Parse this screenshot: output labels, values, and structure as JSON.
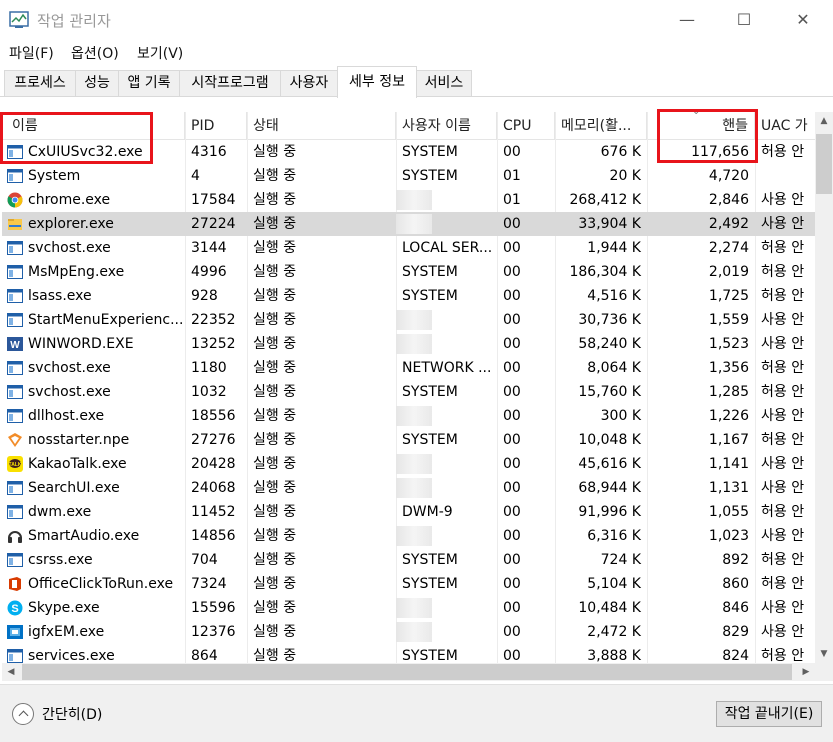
{
  "window": {
    "title": "작업 관리자",
    "minimize_glyph": "—",
    "maximize_glyph": "☐",
    "close_glyph": "✕"
  },
  "menu": [
    "파일(F)",
    "옵션(O)",
    "보기(V)"
  ],
  "tabs": [
    "프로세스",
    "성능",
    "앱 기록",
    "시작프로그램",
    "사용자",
    "세부 정보",
    "서비스"
  ],
  "active_tab": "세부 정보",
  "columns": {
    "name": "이름",
    "pid": "PID",
    "status": "상태",
    "user": "사용자 이름",
    "cpu": "CPU",
    "memory": "메모리(활...",
    "handles": "핸들",
    "uac": "UAC 가"
  },
  "sort_column": "handles",
  "rows": [
    {
      "name": "CxUIUSvc32.exe",
      "pid": "4316",
      "status": "실행 중",
      "user": "SYSTEM",
      "cpu": "00",
      "memory": "676 K",
      "handles": "117,656",
      "uac": "허용 안",
      "icon": "service-window-icon"
    },
    {
      "name": "System",
      "pid": "4",
      "status": "실행 중",
      "user": "SYSTEM",
      "cpu": "01",
      "memory": "20 K",
      "handles": "4,720",
      "uac": "",
      "icon": "service-window-icon"
    },
    {
      "name": "chrome.exe",
      "pid": "17584",
      "status": "실행 중",
      "user": "",
      "cpu": "01",
      "memory": "268,412 K",
      "handles": "2,846",
      "uac": "사용 안",
      "icon": "chrome-icon"
    },
    {
      "name": "explorer.exe",
      "pid": "27224",
      "status": "실행 중",
      "user": "",
      "cpu": "00",
      "memory": "33,904 K",
      "handles": "2,492",
      "uac": "사용 안",
      "icon": "folder-icon"
    },
    {
      "name": "svchost.exe",
      "pid": "3144",
      "status": "실행 중",
      "user": "LOCAL SER...",
      "cpu": "00",
      "memory": "1,944 K",
      "handles": "2,274",
      "uac": "허용 안",
      "icon": "service-window-icon"
    },
    {
      "name": "MsMpEng.exe",
      "pid": "4996",
      "status": "실행 중",
      "user": "SYSTEM",
      "cpu": "00",
      "memory": "186,304 K",
      "handles": "2,019",
      "uac": "허용 안",
      "icon": "service-window-icon"
    },
    {
      "name": "lsass.exe",
      "pid": "928",
      "status": "실행 중",
      "user": "SYSTEM",
      "cpu": "00",
      "memory": "4,516 K",
      "handles": "1,725",
      "uac": "허용 안",
      "icon": "service-window-icon"
    },
    {
      "name": "StartMenuExperienc...",
      "pid": "22352",
      "status": "실행 중",
      "user": "",
      "cpu": "00",
      "memory": "30,736 K",
      "handles": "1,559",
      "uac": "사용 안",
      "icon": "service-window-icon"
    },
    {
      "name": "WINWORD.EXE",
      "pid": "13252",
      "status": "실행 중",
      "user": "",
      "cpu": "00",
      "memory": "58,240 K",
      "handles": "1,523",
      "uac": "사용 안",
      "icon": "word-icon"
    },
    {
      "name": "svchost.exe",
      "pid": "1180",
      "status": "실행 중",
      "user": "NETWORK ...",
      "cpu": "00",
      "memory": "8,064 K",
      "handles": "1,356",
      "uac": "허용 안",
      "icon": "service-window-icon"
    },
    {
      "name": "svchost.exe",
      "pid": "1032",
      "status": "실행 중",
      "user": "SYSTEM",
      "cpu": "00",
      "memory": "15,760 K",
      "handles": "1,285",
      "uac": "허용 안",
      "icon": "service-window-icon"
    },
    {
      "name": "dllhost.exe",
      "pid": "18556",
      "status": "실행 중",
      "user": "",
      "cpu": "00",
      "memory": "300 K",
      "handles": "1,226",
      "uac": "사용 안",
      "icon": "service-window-icon"
    },
    {
      "name": "nosstarter.npe",
      "pid": "27276",
      "status": "실행 중",
      "user": "SYSTEM",
      "cpu": "00",
      "memory": "10,048 K",
      "handles": "1,167",
      "uac": "허용 안",
      "icon": "nosstarter-icon"
    },
    {
      "name": "KakaoTalk.exe",
      "pid": "20428",
      "status": "실행 중",
      "user": "",
      "cpu": "00",
      "memory": "45,616 K",
      "handles": "1,141",
      "uac": "사용 안",
      "icon": "kakaotalk-icon"
    },
    {
      "name": "SearchUI.exe",
      "pid": "24068",
      "status": "실행 중",
      "user": "",
      "cpu": "00",
      "memory": "68,944 K",
      "handles": "1,131",
      "uac": "사용 안",
      "icon": "service-window-icon"
    },
    {
      "name": "dwm.exe",
      "pid": "11452",
      "status": "실행 중",
      "user": "DWM-9",
      "cpu": "00",
      "memory": "91,996 K",
      "handles": "1,055",
      "uac": "허용 안",
      "icon": "service-window-icon"
    },
    {
      "name": "SmartAudio.exe",
      "pid": "14856",
      "status": "실행 중",
      "user": "",
      "cpu": "00",
      "memory": "6,316 K",
      "handles": "1,023",
      "uac": "사용 안",
      "icon": "headphones-icon"
    },
    {
      "name": "csrss.exe",
      "pid": "704",
      "status": "실행 중",
      "user": "SYSTEM",
      "cpu": "00",
      "memory": "724 K",
      "handles": "892",
      "uac": "허용 안",
      "icon": "service-window-icon"
    },
    {
      "name": "OfficeClickToRun.exe",
      "pid": "7324",
      "status": "실행 중",
      "user": "SYSTEM",
      "cpu": "00",
      "memory": "5,104 K",
      "handles": "860",
      "uac": "허용 안",
      "icon": "office-icon"
    },
    {
      "name": "Skype.exe",
      "pid": "15596",
      "status": "실행 중",
      "user": "",
      "cpu": "00",
      "memory": "10,484 K",
      "handles": "846",
      "uac": "사용 안",
      "icon": "skype-icon"
    },
    {
      "name": "igfxEM.exe",
      "pid": "12376",
      "status": "실행 중",
      "user": "",
      "cpu": "00",
      "memory": "2,472 K",
      "handles": "829",
      "uac": "사용 안",
      "icon": "intel-graphics-icon"
    },
    {
      "name": "services.exe",
      "pid": "864",
      "status": "실행 중",
      "user": "SYSTEM",
      "cpu": "00",
      "memory": "3,888 K",
      "handles": "824",
      "uac": "허용 안",
      "icon": "service-window-icon"
    }
  ],
  "selected_row": "explorer.exe",
  "footer": {
    "collapse_label": "간단히(D)",
    "end_task_label": "작업 끝내기(E)"
  },
  "colors": {
    "highlight_box": "#e8141b",
    "selected_row": "#d9d9d9",
    "footer_bg": "#f0f0f0"
  }
}
